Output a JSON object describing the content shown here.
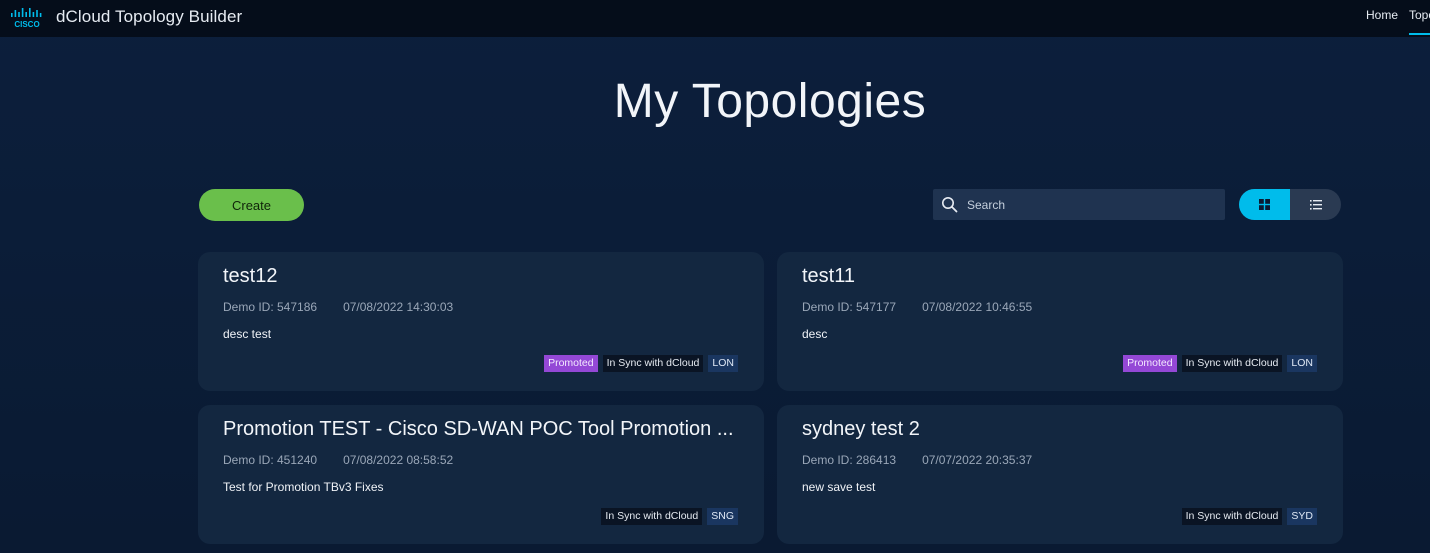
{
  "header": {
    "logo_text": "CISCO",
    "app_title": "dCloud Topology Builder",
    "nav": [
      {
        "label": "Home"
      },
      {
        "label": "Topologies"
      }
    ]
  },
  "page": {
    "title": "My Topologies"
  },
  "toolbar": {
    "create_label": "Create",
    "search_placeholder": "Search"
  },
  "cards": [
    {
      "title": "test12",
      "demo_id": "Demo ID: 547186",
      "date": "07/08/2022 14:30:03",
      "desc": "desc test",
      "badges": [
        "Promoted",
        "In Sync with dCloud",
        "LON"
      ]
    },
    {
      "title": "test11",
      "demo_id": "Demo ID: 547177",
      "date": "07/08/2022 10:46:55",
      "desc": "desc",
      "badges": [
        "Promoted",
        "In Sync with dCloud",
        "LON"
      ]
    },
    {
      "title": "Promotion TEST - Cisco SD-WAN POC Tool Promotion ...",
      "demo_id": "Demo ID: 451240",
      "date": "07/08/2022 08:58:52",
      "desc": "Test for Promotion TBv3 Fixes",
      "badges": [
        "In Sync with dCloud",
        "SNG"
      ]
    },
    {
      "title": "sydney test 2",
      "demo_id": "Demo ID: 286413",
      "date": "07/07/2022 20:35:37",
      "desc": "new save test",
      "badges": [
        "In Sync with dCloud",
        "SYD"
      ]
    }
  ],
  "colors": {
    "accent": "#00bceb",
    "create": "#6abf4b",
    "promoted": "#9448d6"
  }
}
